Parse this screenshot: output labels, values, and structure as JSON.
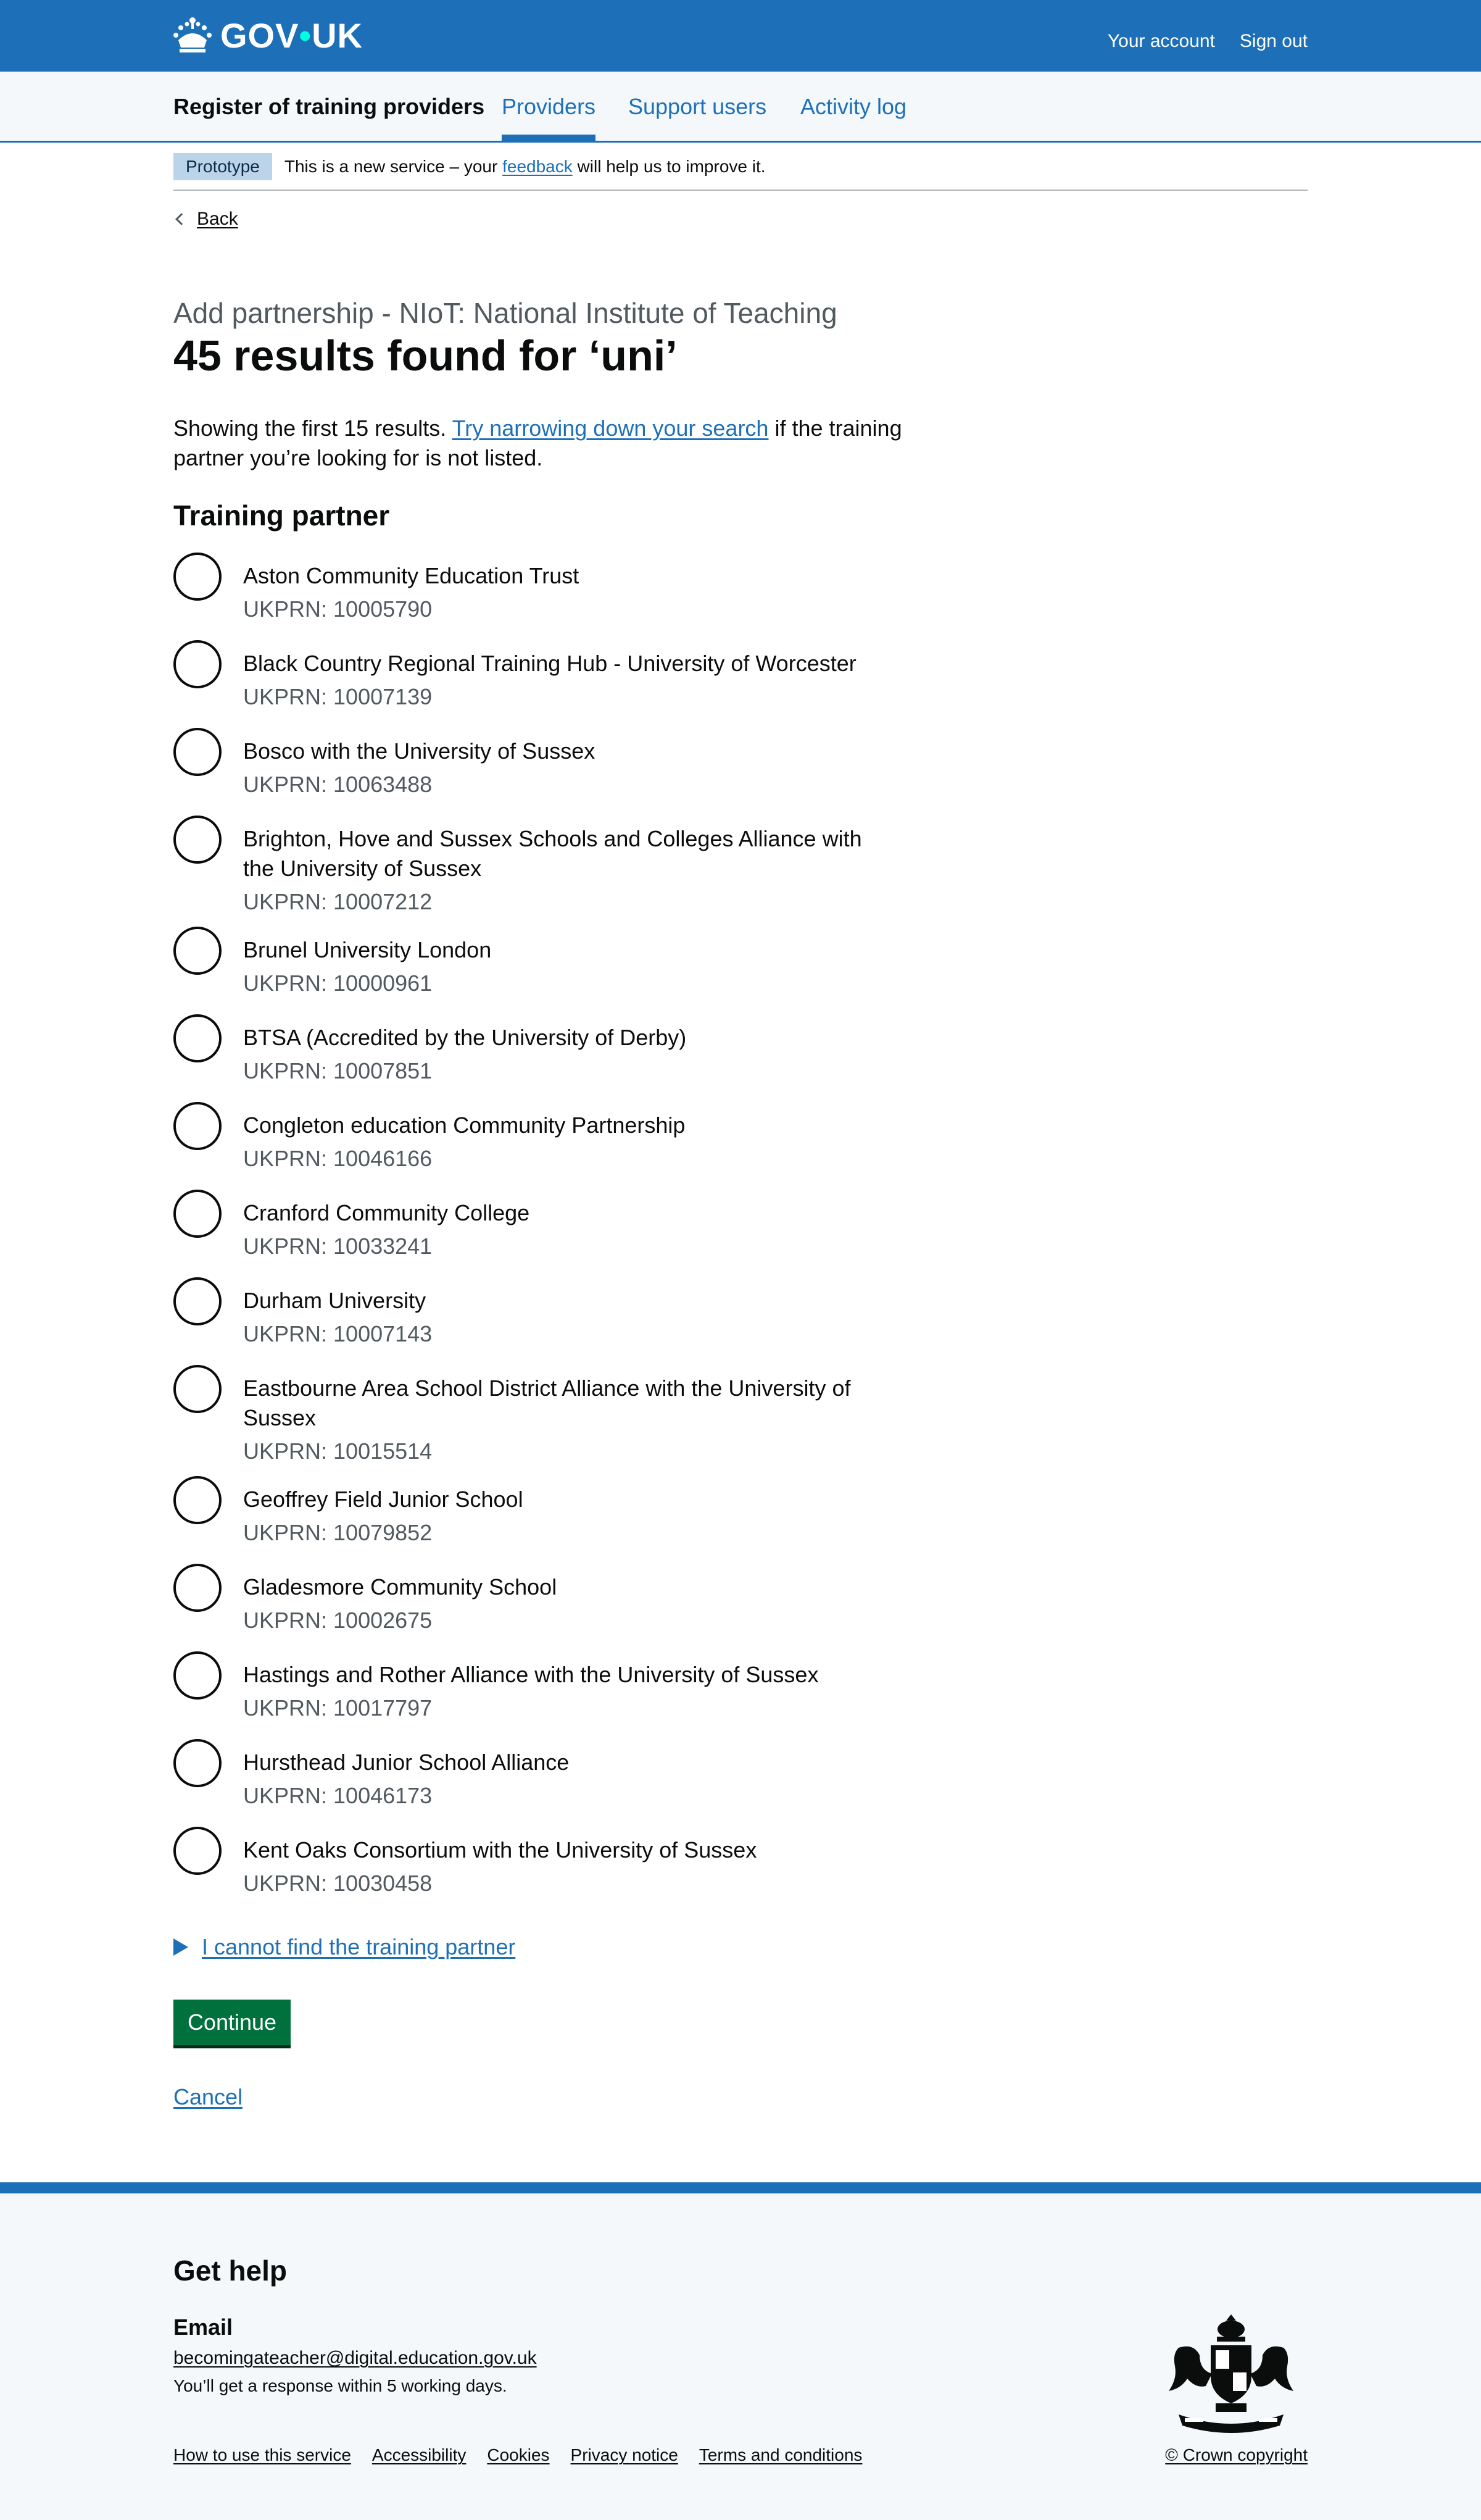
{
  "header": {
    "logo_text": "GOV",
    "logo_text2": "UK",
    "account_label": "Your account",
    "signout_label": "Sign out"
  },
  "service_nav": {
    "service_name": "Register of training providers",
    "items": [
      {
        "label": "Providers",
        "active": true
      },
      {
        "label": "Support users",
        "active": false
      },
      {
        "label": "Activity log",
        "active": false
      }
    ]
  },
  "phase_banner": {
    "tag": "Prototype",
    "text_before": "This is a new service – your ",
    "link": "feedback",
    "text_after": " will help us to improve it."
  },
  "back_label": "Back",
  "caption": "Add partnership - NIoT: National Institute of Teaching",
  "heading": "45 results found for ‘uni’",
  "lead": {
    "before": "Showing the first 15 results. ",
    "link": "Try narrowing down your search",
    "after": " if the training partner you’re looking for is not listed."
  },
  "legend": "Training partner",
  "partners": [
    {
      "name": "Aston Community Education Trust",
      "ukprn": "UKPRN: 10005790"
    },
    {
      "name": "Black Country Regional Training Hub - University of Worcester",
      "ukprn": "UKPRN: 10007139"
    },
    {
      "name": "Bosco with the University of Sussex",
      "ukprn": "UKPRN: 10063488"
    },
    {
      "name": "Brighton, Hove and Sussex Schools and Colleges Alliance with the University of Sussex",
      "ukprn": "UKPRN: 10007212"
    },
    {
      "name": "Brunel University London",
      "ukprn": "UKPRN: 10000961"
    },
    {
      "name": "BTSA (Accredited by the University of Derby)",
      "ukprn": "UKPRN: 10007851"
    },
    {
      "name": "Congleton education Community Partnership",
      "ukprn": "UKPRN: 10046166"
    },
    {
      "name": "Cranford Community College",
      "ukprn": "UKPRN: 10033241"
    },
    {
      "name": "Durham University",
      "ukprn": "UKPRN: 10007143"
    },
    {
      "name": "Eastbourne Area School District Alliance with the University of Sussex",
      "ukprn": "UKPRN: 10015514"
    },
    {
      "name": "Geoffrey Field Junior School",
      "ukprn": "UKPRN: 10079852"
    },
    {
      "name": "Gladesmore Community School",
      "ukprn": "UKPRN: 10002675"
    },
    {
      "name": "Hastings and Rother Alliance with the University of Sussex",
      "ukprn": "UKPRN: 10017797"
    },
    {
      "name": "Hursthead Junior School Alliance",
      "ukprn": "UKPRN: 10046173"
    },
    {
      "name": "Kent Oaks Consortium with the University of Sussex",
      "ukprn": "UKPRN: 10030458"
    }
  ],
  "details_label": "I cannot find the training partner",
  "continue_label": "Continue",
  "cancel_label": "Cancel",
  "footer": {
    "title": "Get help",
    "email_heading": "Email",
    "email": "becomingateacher@digital.education.gov.uk",
    "response": "You’ll get a response within 5 working days.",
    "links": [
      "How to use this service",
      "Accessibility",
      "Cookies",
      "Privacy notice",
      "Terms and conditions"
    ],
    "copyright": "© Crown copyright"
  },
  "colors": {
    "brand_blue": "#1d70b8",
    "button_green": "#00703c",
    "tag_bg": "#bbd4ea",
    "footer_bg": "#f4f8fb"
  }
}
